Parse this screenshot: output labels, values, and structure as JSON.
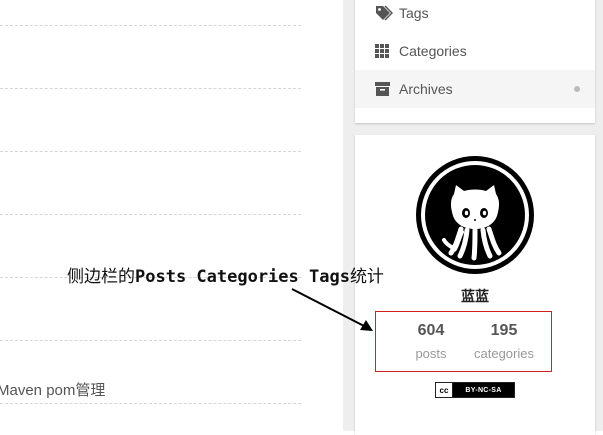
{
  "main": {
    "post_title": "Maven pom管理"
  },
  "sidebar": {
    "menu": [
      {
        "label": "Tags",
        "icon": "tags-icon"
      },
      {
        "label": "Categories",
        "icon": "th-icon"
      },
      {
        "label": "Archives",
        "icon": "archive-icon",
        "active": true
      }
    ],
    "author": {
      "name": "蓝蓝",
      "avatar_icon": "github-octocat-icon"
    },
    "stats": {
      "posts_count": "604",
      "posts_label": "posts",
      "categories_count": "195",
      "categories_label": "categories"
    },
    "license": {
      "cc_mark": "cc",
      "text": "BY-NC-SA"
    }
  },
  "annotation": {
    "prefix": "侧边栏的",
    "latin": "Posts Categories Tags",
    "suffix": "统计",
    "color": "#d61f1f"
  }
}
